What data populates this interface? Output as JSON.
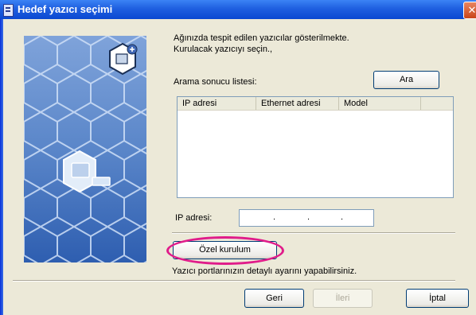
{
  "window": {
    "title": "Hedef yazıcı seçimi",
    "close_glyph": "✕"
  },
  "text": {
    "line1": "Ağınızda tespit edilen yazıcılar gösterilmekte.",
    "line2": "Kurulacak yazıcıyı seçin.,",
    "list_label": "Arama sonucu listesi:",
    "ip_label": "IP adresi:",
    "custom_desc": "Yazıcı portlarınızın detaylı ayarını yapabilirsiniz."
  },
  "buttons": {
    "search": "Ara",
    "custom_install": "Özel kurulum",
    "back": "Geri",
    "next": "İleri",
    "cancel": "İptal"
  },
  "list_columns": [
    "IP adresi",
    "Ethernet adresi",
    "Model"
  ],
  "ip_field": {
    "dots": [
      ".",
      ".",
      "."
    ]
  },
  "icons": [
    "app-icon",
    "close-icon",
    "printer-network-icon",
    "printer-icon"
  ],
  "colors": {
    "titlebar": "#0a48d1",
    "dialog": "#ece9d8",
    "highlight": "#e01c8a",
    "art": "#2b64b4"
  }
}
